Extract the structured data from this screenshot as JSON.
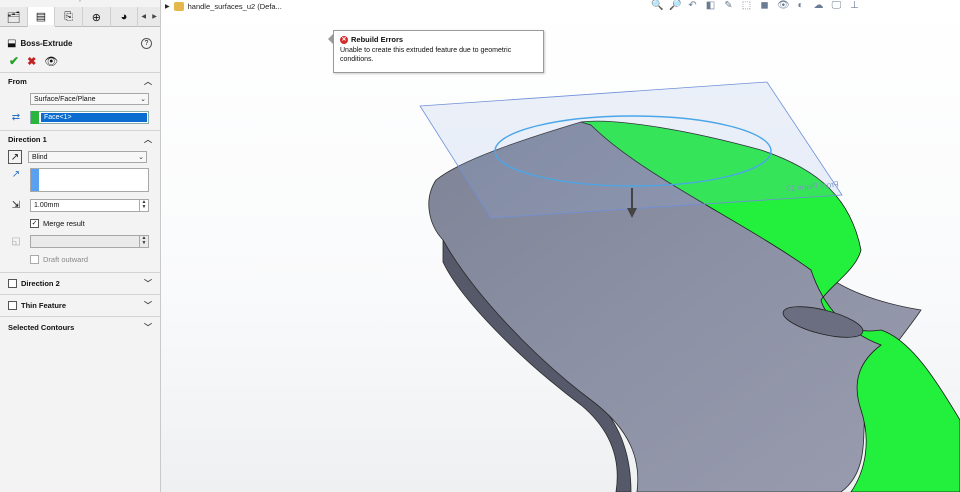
{
  "property_manager": {
    "tabs": [
      "feature-manager-icon",
      "property-manager-icon",
      "configuration-manager-icon",
      "dimxpert-icon",
      "display-manager-icon"
    ],
    "feature_title": "Boss-Extrude",
    "help_glyph": "?",
    "from": {
      "header": "From",
      "start_condition": "Surface/Face/Plane",
      "selected_face": "Face<1>"
    },
    "direction1": {
      "header": "Direction 1",
      "end_condition": "Blind",
      "depth": "1.00mm",
      "merge_result_label": "Merge result",
      "merge_result_checked": true,
      "draft_outward_label": "Draft outward",
      "draft_outward_checked": false
    },
    "sections": {
      "direction2": "Direction 2",
      "thin_feature": "Thin Feature",
      "selected_contours": "Selected Contours"
    }
  },
  "viewport": {
    "tree_item": "handle_surfaces_u2  (Defa...",
    "error_popup": {
      "title": "Rebuild Errors",
      "message": "Unable to create this extruded feature due to geometric conditions."
    },
    "plane_label": "Front Plane 10",
    "colors": {
      "selected_face": "#22f03c",
      "body": "#8c90a4",
      "plane": "#6f8fd8",
      "sketch": "#4aa6e8"
    }
  }
}
